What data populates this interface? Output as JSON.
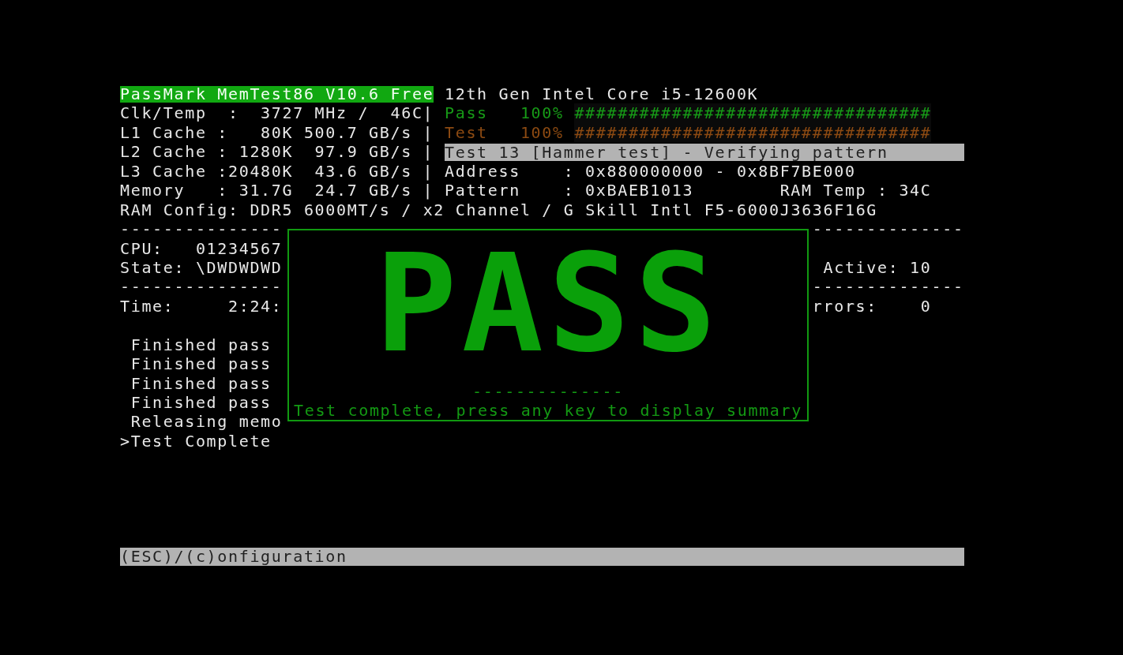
{
  "header": {
    "title": "PassMark MemTest86 V10.6 Free",
    "cpu_model": "12th Gen Intel Core i5-12600K"
  },
  "rows": [
    {
      "left": "Clk/Temp  :  3727 MHz /  46C",
      "sep": "|",
      "right": {
        "kind": "progress",
        "label": "Pass",
        "percent": "100%",
        "level": 1,
        "glyph": "#",
        "color": "#179a17"
      }
    },
    {
      "left": "L1 Cache :   80K 500.7 GB/s",
      "sep": "|",
      "right": {
        "kind": "progress",
        "label": "Test",
        "percent": "100%",
        "level": 1,
        "glyph": "#",
        "color": "#8c4a12"
      }
    },
    {
      "left": "L2 Cache : 1280K  97.9 GB/s",
      "sep": "|",
      "right": {
        "kind": "banner",
        "text": "Test 13 [Hammer test] - Verifying pattern"
      }
    },
    {
      "left": "L3 Cache :20480K  43.6 GB/s",
      "sep": "|",
      "right": {
        "kind": "field",
        "text": "Address    : 0x880000000 - 0x8BF7BE000"
      }
    },
    {
      "left": "Memory   : 31.7G  24.7 GB/s",
      "sep": "|",
      "right": {
        "kind": "field",
        "text": "Pattern    : 0xBAEB1013",
        "extra": "RAM Temp : 34C"
      }
    }
  ],
  "ram_config": "RAM Config: DDR5 6000MT/s / x2 Channel / G Skill Intl F5-6000J3636F16G",
  "cpu_panel": {
    "rule_top": "---------------",
    "cpu": "CPU:   01234567",
    "state": "State: \\DWDWDWD",
    "rule_bottom": "---------------",
    "time": "Time:     2:24:"
  },
  "right_panel": {
    "rule_top": "--------------",
    "active": "Active: 10",
    "rule_bottom": "--------------",
    "errors": "rrors:    0"
  },
  "log": [
    {
      "text": "Finished pass",
      "current": false
    },
    {
      "text": "Finished pass",
      "current": false
    },
    {
      "text": "Finished pass",
      "current": false
    },
    {
      "text": "Finished pass",
      "current": false
    },
    {
      "text": "Releasing memo",
      "current": false
    },
    {
      "text": ">Test Complete",
      "current": true
    }
  ],
  "popup": {
    "banner": "PASS",
    "rule": "--------------",
    "message": "Test complete, press any key to display summary"
  },
  "footer": "(ESC)/(c)onfiguration"
}
